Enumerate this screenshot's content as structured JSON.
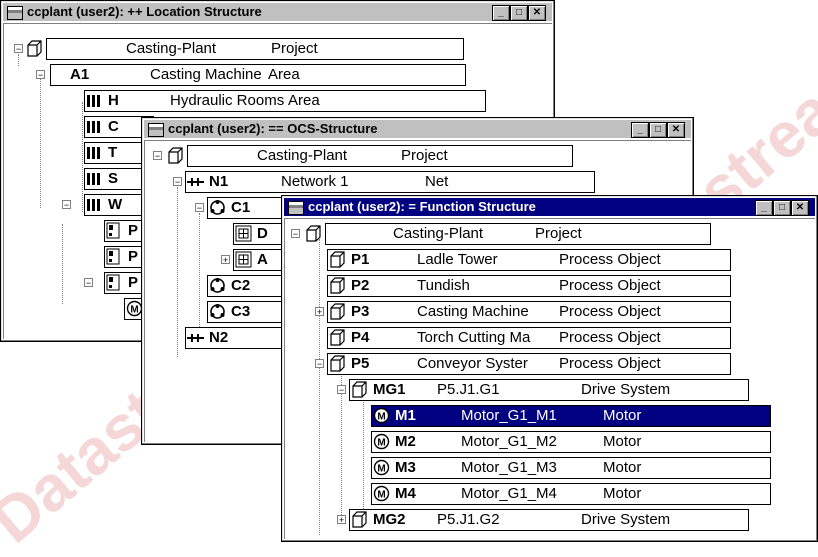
{
  "windows": {
    "location": {
      "title": "ccplant (user2): ++ Location Structure",
      "rows": [
        {
          "code": "",
          "name": "Casting-Plant",
          "type": "Project"
        },
        {
          "code": "A1",
          "name": "Casting Machine",
          "type": "Area"
        },
        {
          "code": "H",
          "name": "Hydraulic Rooms",
          "type": "Area"
        },
        {
          "code": "C",
          "name": "",
          "type": ""
        },
        {
          "code": "T",
          "name": "",
          "type": ""
        },
        {
          "code": "S",
          "name": "",
          "type": ""
        },
        {
          "code": "W",
          "name": "",
          "type": ""
        },
        {
          "code": "P",
          "name": "",
          "type": ""
        },
        {
          "code": "P",
          "name": "",
          "type": ""
        },
        {
          "code": "P",
          "name": "",
          "type": ""
        }
      ]
    },
    "ocs": {
      "title": "ccplant (user2): == OCS-Structure",
      "rows": [
        {
          "code": "",
          "name": "Casting-Plant",
          "type": "Project"
        },
        {
          "code": "N1",
          "name": "Network 1",
          "type": "Net"
        },
        {
          "code": "C1",
          "name": "",
          "type": ""
        },
        {
          "code": "D",
          "name": "",
          "type": ""
        },
        {
          "code": "A",
          "name": "",
          "type": ""
        },
        {
          "code": "C2",
          "name": "",
          "type": ""
        },
        {
          "code": "C3",
          "name": "",
          "type": ""
        },
        {
          "code": "N2",
          "name": "",
          "type": ""
        }
      ]
    },
    "function": {
      "title": "ccplant (user2): = Function Structure",
      "rows": [
        {
          "code": "",
          "name": "Casting-Plant",
          "type": "Project"
        },
        {
          "code": "P1",
          "name": "Ladle Tower",
          "type": "Process Object"
        },
        {
          "code": "P2",
          "name": "Tundish",
          "type": "Process Object"
        },
        {
          "code": "P3",
          "name": "Casting Machine",
          "type": "Process Object"
        },
        {
          "code": "P4",
          "name": "Torch Cutting Ma",
          "type": "Process Object"
        },
        {
          "code": "P5",
          "name": "Conveyor Syster",
          "type": "Process Object"
        },
        {
          "code": "MG1",
          "name": "P5.J1.G1",
          "type": "Drive System"
        },
        {
          "code": "M1",
          "name": "Motor_G1_M1",
          "type": "Motor"
        },
        {
          "code": "M2",
          "name": "Motor_G1_M2",
          "type": "Motor"
        },
        {
          "code": "M3",
          "name": "Motor_G1_M3",
          "type": "Motor"
        },
        {
          "code": "M4",
          "name": "Motor_G1_M4",
          "type": "Motor"
        },
        {
          "code": "MG2",
          "name": "P5.J1.G2",
          "type": "Drive System"
        }
      ]
    }
  },
  "watermark": "Datastream",
  "colors": {
    "titlebar_active": "#000080",
    "titlebar_inactive": "#c0c0c0",
    "selection": "#000080",
    "watermark": "#f6d7d7"
  }
}
